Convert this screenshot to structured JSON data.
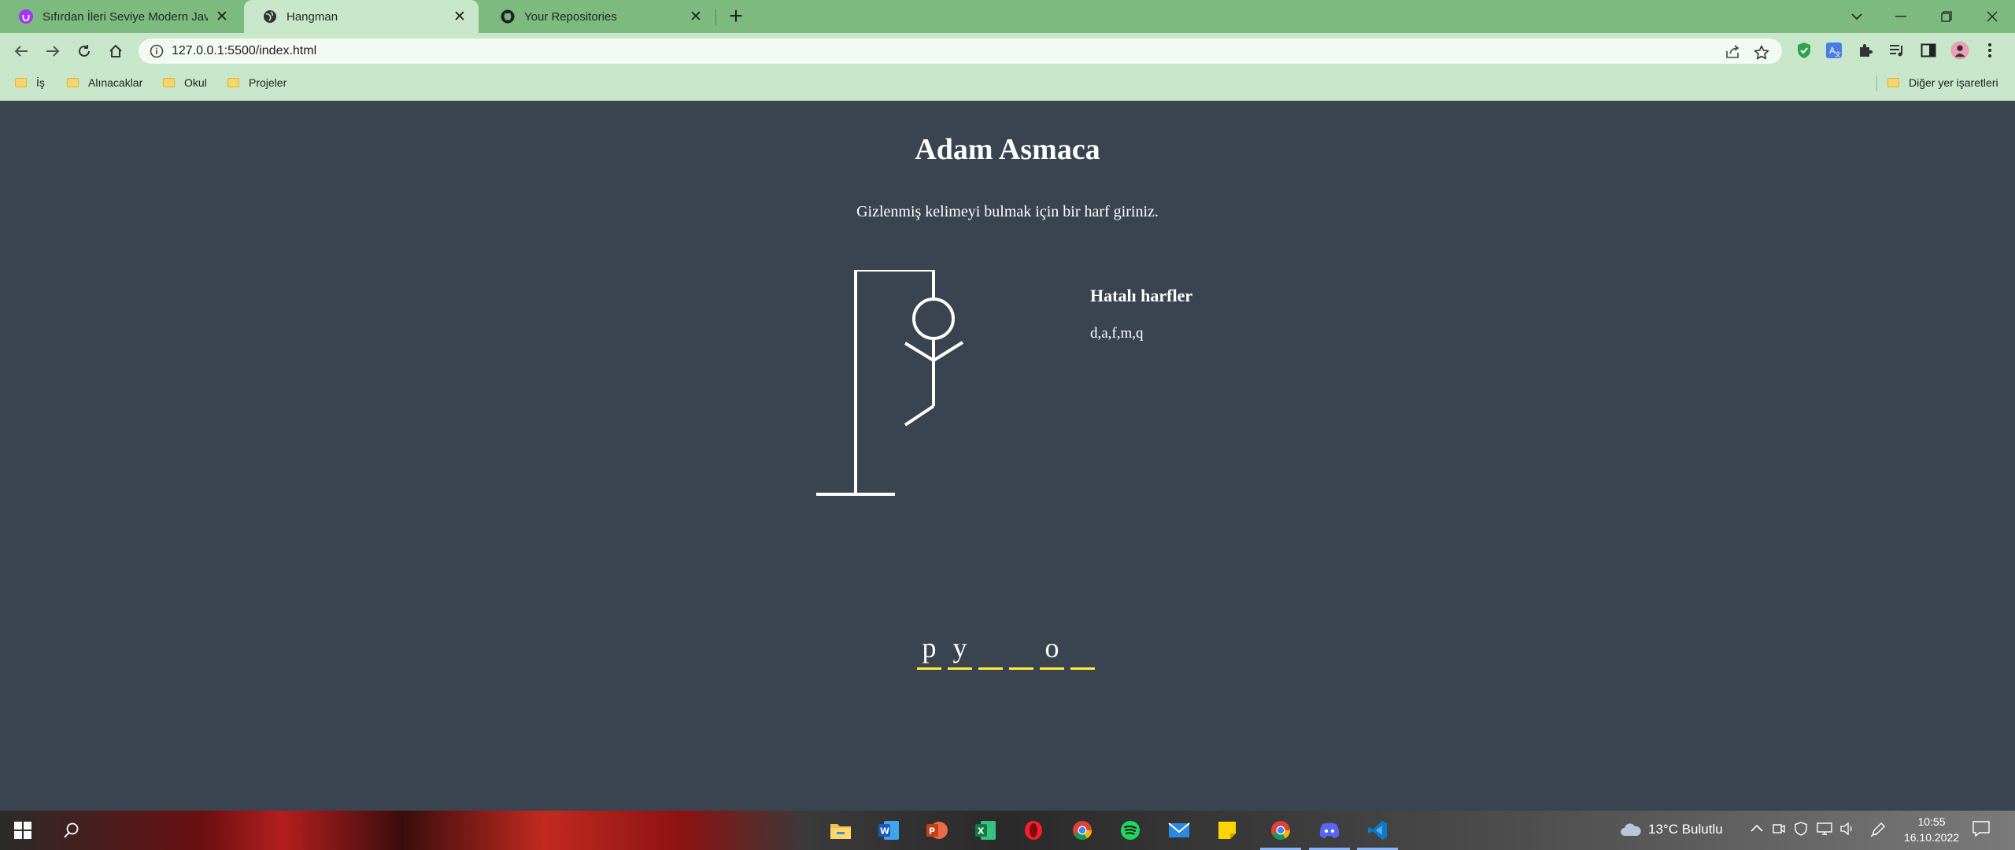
{
  "browser": {
    "tabs": [
      {
        "title": "Sıfırdan İleri Seviye Modern Javascript",
        "icon": "udemy-icon",
        "active": false
      },
      {
        "title": "Hangman",
        "icon": "globe-icon",
        "active": true
      },
      {
        "title": "Your Repositories",
        "icon": "github-icon",
        "active": false
      }
    ],
    "url": "127.0.0.1:5500/index.html",
    "bookmarks": [
      "İş",
      "Alınacaklar",
      "Okul",
      "Projeler"
    ],
    "other_bookmarks": "Diğer yer işaretleri"
  },
  "game": {
    "title": "Adam Asmaca",
    "instructions": "Gizlenmiş kelimeyi bulmak için bir harf giriniz.",
    "wrong_letters_title": "Hatalı harfler",
    "wrong_letters": "d,a,f,m,q",
    "word_letters": [
      "p",
      "y",
      "",
      "",
      "o",
      ""
    ]
  },
  "taskbar": {
    "weather": "13°C  Bulutlu",
    "time": "10:55",
    "date": "16.10.2022"
  },
  "colors": {
    "tab_strip": "#7dba7f",
    "toolbar": "#c8e6c9",
    "page_bg": "#3a4450",
    "letter_underline": "#ffeb3b"
  }
}
